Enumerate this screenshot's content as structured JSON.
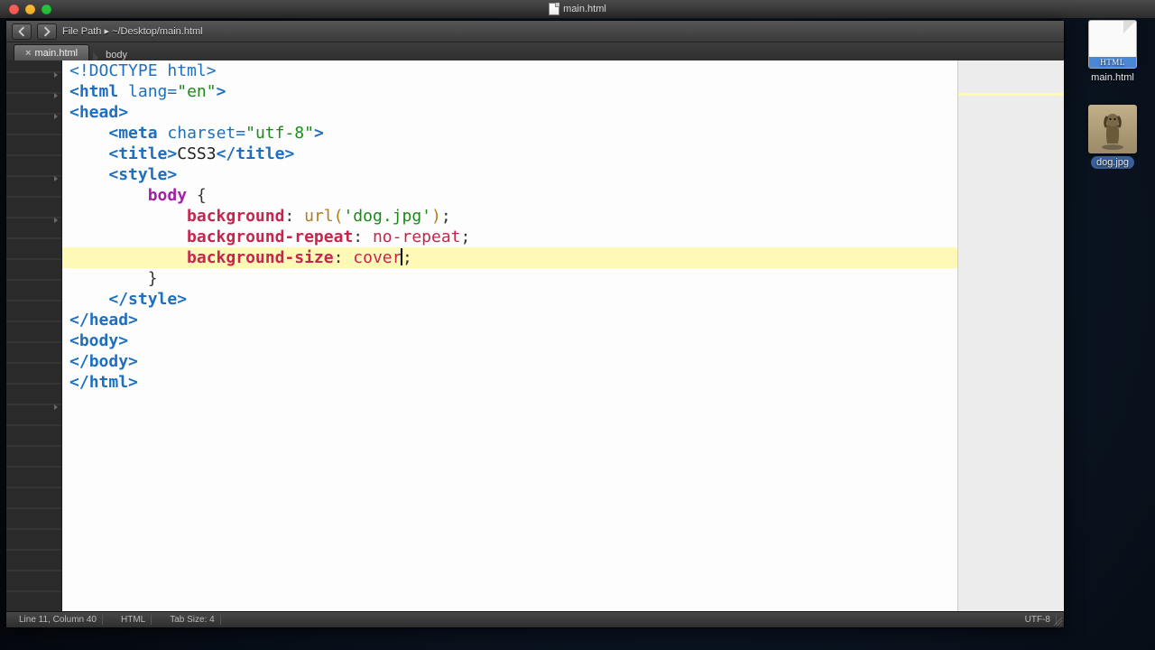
{
  "os": {
    "window_title": "main.html"
  },
  "editor": {
    "toolbar": {
      "path": "File Path ▸ ~/Desktop/main.html"
    },
    "tabs": [
      {
        "label": "main.html",
        "close": "×"
      }
    ],
    "breadcrumb": [
      "body"
    ],
    "status": {
      "line_col": "Line 11, Column 40",
      "syntax": "HTML",
      "encoding": "UTF-8",
      "tabsize": "Tab Size: 4"
    },
    "code": {
      "l1": "<!DOCTYPE html>",
      "l2": {
        "open": "<",
        "tag": "html",
        "attr": " lang=",
        "str": "\"en\"",
        "close": ">"
      },
      "l3": {
        "open": "<",
        "tag": "head",
        "close": ">"
      },
      "l4": {
        "indent": "    ",
        "open": "<",
        "tag": "meta",
        "attr": " charset=",
        "str": "\"utf-8\"",
        "close": ">"
      },
      "l5": {
        "indent": "    ",
        "open": "<",
        "tag": "title",
        "close": ">",
        "text": "CSS3",
        "open2": "</",
        "tag2": "title",
        "close2": ">"
      },
      "l6": {
        "indent": "    ",
        "open": "<",
        "tag": "style",
        "close": ">"
      },
      "l7": "",
      "l8": {
        "indent": "        ",
        "sel": "body",
        "brace": " {"
      },
      "l9": {
        "indent": "            ",
        "prop": "background",
        "colon": ": ",
        "fn": "url(",
        "str": "'dog.jpg'",
        "fnc": ")",
        "semi": ";"
      },
      "l10": {
        "indent": "            ",
        "prop": "background-repeat",
        "colon": ": ",
        "val": "no-repeat",
        "semi": ";"
      },
      "l11": "",
      "l12": {
        "indent": "            ",
        "prop": "background-size",
        "colon": ": ",
        "val": "cover",
        "semi": ";"
      },
      "l13": {
        "indent": "        ",
        "brace": "}"
      },
      "l14": "",
      "l15": {
        "indent": "    ",
        "open": "</",
        "tag": "style",
        "close": ">"
      },
      "l16": {
        "open": "</",
        "tag": "head",
        "close": ">"
      },
      "l17": {
        "open": "<",
        "tag": "body",
        "close": ">"
      },
      "l18": "",
      "l19": {
        "open": "</",
        "tag": "body",
        "close": ">"
      },
      "l20": {
        "open": "</",
        "tag": "html",
        "close": ">"
      }
    }
  },
  "desktop": {
    "file1": {
      "label": "main.html",
      "badge": "HTML"
    },
    "file2": {
      "label": "dog.jpg"
    }
  }
}
